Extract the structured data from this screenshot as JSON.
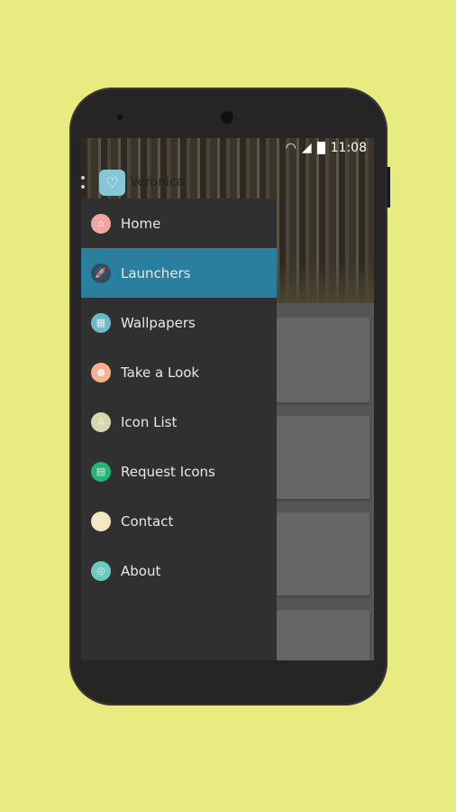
{
  "status": {
    "time": "11:08",
    "icons": [
      "wifi-icon",
      "signal-icon",
      "battery-icon"
    ]
  },
  "app": {
    "title": "Veronica"
  },
  "drawer": {
    "selected": "Launchers",
    "items": [
      {
        "label": "Home",
        "icon": "home-icon",
        "color": "#f3a6a0",
        "glyph": "⌂"
      },
      {
        "label": "Launchers",
        "icon": "rocket-icon",
        "color": "#2f4e5f",
        "glyph": "🚀"
      },
      {
        "label": "Wallpapers",
        "icon": "image-icon",
        "color": "#6bb9cc",
        "glyph": "▦"
      },
      {
        "label": "Take a Look",
        "icon": "magnifier-icon",
        "color": "#f8b08c",
        "glyph": "●"
      },
      {
        "label": "Icon List",
        "icon": "abc-blocks-icon",
        "color": "#d9d6b0",
        "glyph": "A"
      },
      {
        "label": "Request Icons",
        "icon": "document-icon",
        "color": "#22b573",
        "glyph": "▤"
      },
      {
        "label": "Contact",
        "icon": "envelope-icon",
        "color": "#f3e7c0",
        "glyph": "✉"
      },
      {
        "label": "About",
        "icon": "lollipop-icon",
        "color": "#6cc9c0",
        "glyph": "◎"
      }
    ]
  },
  "colors": {
    "accent": "#2a7f9e",
    "drawer": "#303030",
    "background": "#e8ec80"
  }
}
